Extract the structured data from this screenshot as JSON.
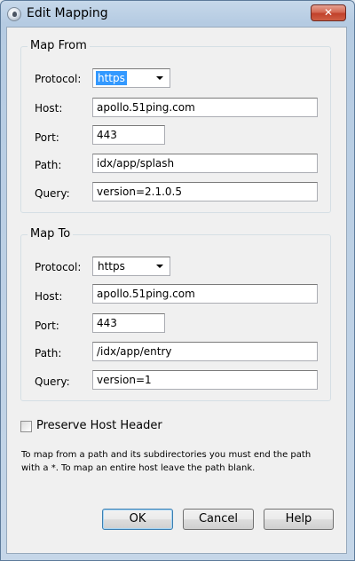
{
  "window": {
    "title": "Edit Mapping",
    "close_label": "✕"
  },
  "map_from": {
    "legend": "Map From",
    "protocol_label": "Protocol:",
    "protocol_value": "https",
    "host_label": "Host:",
    "host_value": "apollo.51ping.com",
    "port_label": "Port:",
    "port_value": "443",
    "path_label": "Path:",
    "path_value": "idx/app/splash",
    "query_label": "Query:",
    "query_value": "version=2.1.0.5"
  },
  "map_to": {
    "legend": "Map To",
    "protocol_label": "Protocol:",
    "protocol_value": "https",
    "host_label": "Host:",
    "host_value": "apollo.51ping.com",
    "port_label": "Port:",
    "port_value": "443",
    "path_label": "Path:",
    "path_value": "/idx/app/entry",
    "query_label": "Query:",
    "query_value": "version=1"
  },
  "options": {
    "preserve_host_label": "Preserve Host Header",
    "preserve_host_checked": false
  },
  "help_text": "To map from a path and its subdirectories you must end the path with a *. To map an entire host leave the path blank.",
  "buttons": {
    "ok": "OK",
    "cancel": "Cancel",
    "help": "Help"
  },
  "icons": {
    "app": "charles-proxy-icon",
    "close": "close-icon",
    "dropdown": "chevron-down-icon"
  }
}
